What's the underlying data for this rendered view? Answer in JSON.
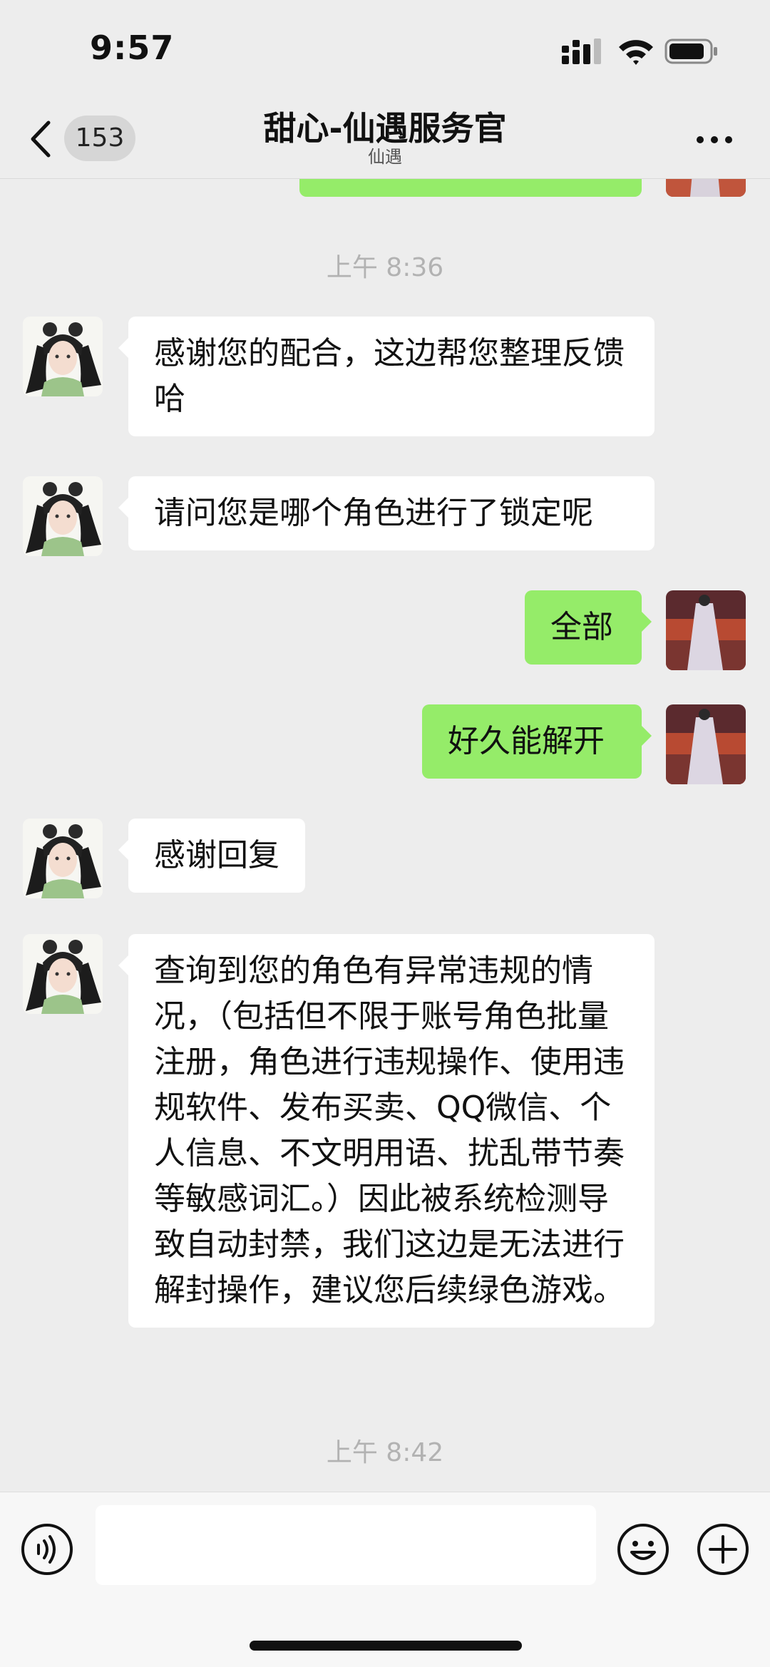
{
  "status_bar": {
    "time": "9:57"
  },
  "header": {
    "back_badge": "153",
    "title": "甜心-仙遇服务官",
    "subtitle": "仙遇"
  },
  "messages": [
    {
      "time": "上午 8:36"
    },
    {
      "side": "left",
      "text": "感谢您的配合，这边帮您整理反馈哈"
    },
    {
      "side": "left",
      "text": "请问您是哪个角色进行了锁定呢"
    },
    {
      "side": "right",
      "text": "全部"
    },
    {
      "side": "right",
      "text": "好久能解开"
    },
    {
      "side": "left",
      "text": "感谢回复"
    },
    {
      "side": "left",
      "text": "查询到您的角色有异常违规的情况，（包括但不限于账号角色批量注册，角色进行违规操作、使用违规软件、发布买卖、QQ微信、个人信息、不文明用语、扰乱带节奏等敏感词汇。）因此被系统检测导致自动封禁，我们这边是无法进行解封操作，建议您后续绿色游戏。"
    },
    {
      "time": "上午 8:42"
    }
  ],
  "input_bar": {
    "placeholder": ""
  },
  "colors": {
    "background": "#ededed",
    "self_bubble": "#95ec69",
    "other_bubble": "#ffffff",
    "time_label": "#b2b2b2"
  }
}
